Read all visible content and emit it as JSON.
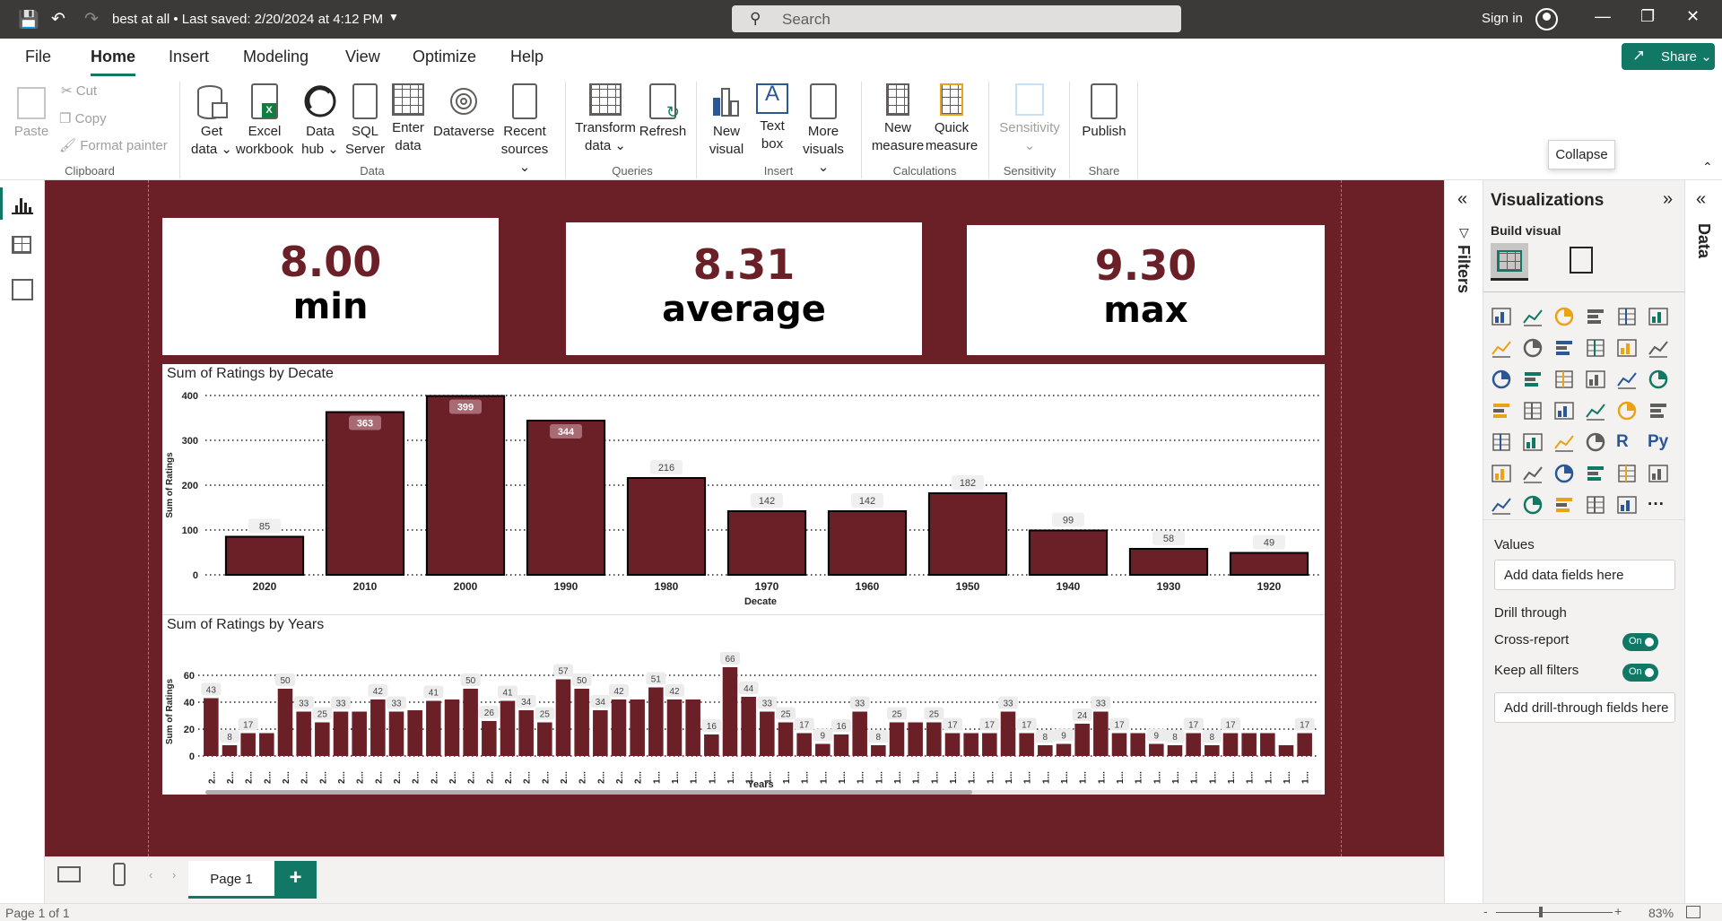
{
  "titlebar": {
    "doc_title": "best at all  •  Last saved: 2/20/2024 at 4:12 PM",
    "search_placeholder": "Search",
    "signin": "Sign in"
  },
  "tabs": [
    "File",
    "Home",
    "Insert",
    "Modeling",
    "View",
    "Optimize",
    "Help"
  ],
  "share_label": "Share",
  "ribbon": {
    "clipboard": {
      "paste": "Paste",
      "cut": "Cut",
      "copy": "Copy",
      "format_painter": "Format painter",
      "group": "Clipboard"
    },
    "data": {
      "get_data": "Get data",
      "excel": "Excel workbook",
      "hub": "Data hub",
      "sql": "SQL Server",
      "enter": "Enter data",
      "dataverse": "Dataverse",
      "recent": "Recent sources",
      "group": "Data"
    },
    "queries": {
      "transform": "Transform data",
      "refresh": "Refresh",
      "group": "Queries"
    },
    "insert": {
      "new_visual": "New visual",
      "text_box": "Text box",
      "more_visuals": "More visuals",
      "group": "Insert"
    },
    "calculations": {
      "new_measure": "New measure",
      "quick_measure": "Quick measure",
      "group": "Calculations"
    },
    "sensitivity": {
      "label": "Sensitivity",
      "group": "Sensitivity"
    },
    "share": {
      "publish": "Publish",
      "group": "Share"
    },
    "collapse_tooltip": "Collapse"
  },
  "cards": [
    {
      "value": "8.00",
      "label": "min"
    },
    {
      "value": "8.31",
      "label": "average"
    },
    {
      "value": "9.30",
      "label": "max"
    }
  ],
  "chart_data": [
    {
      "type": "bar",
      "title": "Sum of Ratings by Decate",
      "xlabel": "Decate",
      "ylabel": "Sum of Ratings",
      "categories": [
        "2020",
        "2010",
        "2000",
        "1990",
        "1980",
        "1970",
        "1960",
        "1950",
        "1940",
        "1930",
        "1920"
      ],
      "values": [
        85,
        363,
        399,
        344,
        216,
        142,
        142,
        182,
        99,
        58,
        49
      ],
      "yticks": [
        0,
        100,
        200,
        300,
        400
      ],
      "ylim": [
        0,
        400
      ],
      "color": "#6b2028",
      "grid": true
    },
    {
      "type": "bar",
      "title": "Sum of Ratings by Years",
      "xlabel": "Years",
      "ylabel": "Sum of Ratings",
      "tick_label": "2...",
      "tick_label_alt": "1...",
      "values": [
        43,
        8,
        17,
        17,
        50,
        33,
        25,
        33,
        33,
        42,
        33,
        34,
        41,
        42,
        50,
        26,
        41,
        34,
        25,
        57,
        50,
        34,
        42,
        42,
        51,
        42,
        42,
        16,
        66,
        44,
        33,
        25,
        17,
        9,
        16,
        33,
        8,
        25,
        25,
        25,
        17,
        17,
        17,
        33,
        17,
        8,
        9,
        24,
        33,
        17,
        17,
        9,
        8,
        17,
        8,
        17,
        17,
        17,
        8,
        17
      ],
      "data_labels": [
        43,
        8,
        17,
        null,
        50,
        33,
        25,
        33,
        null,
        42,
        33,
        null,
        41,
        null,
        50,
        26,
        41,
        34,
        25,
        57,
        50,
        34,
        42,
        null,
        51,
        42,
        null,
        16,
        66,
        44,
        33,
        25,
        17,
        9,
        16,
        33,
        8,
        25,
        null,
        25,
        17,
        null,
        17,
        33,
        17,
        8,
        9,
        24,
        33,
        17,
        null,
        9,
        8,
        17,
        8,
        17,
        null,
        null,
        null,
        17
      ],
      "yticks": [
        0,
        20,
        40,
        60
      ],
      "ylim": [
        0,
        66
      ],
      "color": "#6b2028",
      "grid": true
    }
  ],
  "pages": {
    "tab": "Page 1",
    "add": "+",
    "status": "Page 1 of 1",
    "zoom": "83%"
  },
  "panes": {
    "filters": "Filters",
    "visualizations": "Visualizations",
    "build_visual": "Build visual",
    "data": "Data",
    "values": "Values",
    "add_data_fields": "Add data fields here",
    "drill_through": "Drill through",
    "cross_report": "Cross-report",
    "keep_all_filters": "Keep all filters",
    "toggle_on": "On",
    "add_drill_fields": "Add drill-through fields here"
  },
  "viz_icons": [
    "stacked-bar-icon",
    "stacked-column-icon",
    "clustered-bar-icon",
    "clustered-column-icon",
    "100-bar-icon",
    "100-column-icon",
    "line-chart-icon",
    "area-chart-icon",
    "stacked-area-icon",
    "line-column-icon",
    "line-clustered-icon",
    "ribbon-chart-icon",
    "waterfall-icon",
    "funnel-icon",
    "scatter-icon",
    "pie-icon",
    "donut-icon",
    "treemap-icon",
    "map-icon",
    "filled-map-icon",
    "azure-map-icon",
    "gauge-icon",
    "card-icon",
    "multirow-card-icon",
    "kpi-icon",
    "slicer-icon",
    "table-icon",
    "matrix-icon",
    "r-visual-icon",
    "python-visual-icon",
    "key-influencers-icon",
    "decomposition-tree-icon",
    "qa-icon",
    "narrative-icon",
    "goals-icon",
    "paginated-icon",
    "arcgis-icon",
    "power-apps-icon",
    "power-automate-icon",
    "diamond-icon",
    "chevrons-icon",
    "more-icon"
  ],
  "viz_labels": {
    "r": "R",
    "py": "Py",
    "more": "···"
  }
}
